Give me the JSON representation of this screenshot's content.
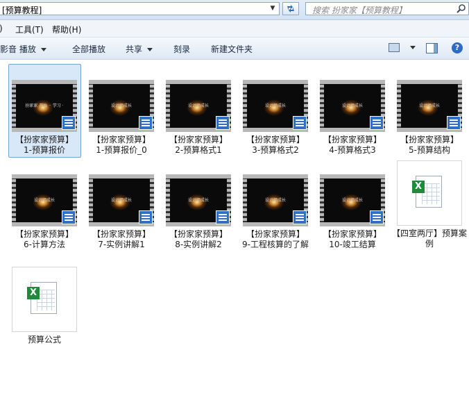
{
  "address": {
    "path": "[预算教程]",
    "search_placeholder": "搜索 扮家家【预算教程】"
  },
  "menu": {
    "tools": "工具(T)",
    "help": "帮助(H)",
    "left_partial": ")"
  },
  "commands": {
    "play_with": "影音 播放",
    "play_all": "全部播放",
    "share": "共享",
    "burn": "刻录",
    "new_folder": "新建文件夹"
  },
  "colors": {
    "accent": "#2f6fc6",
    "excel": "#1e8a3a",
    "selection": "#d9e8f8"
  },
  "files": [
    {
      "type": "video",
      "label": "【扮家家预算】1-预算报价",
      "thumb_text": "扮家家 开始 ·· 学习 ·"
    },
    {
      "type": "video",
      "label": "【扮家家预算】1-预算报价_0",
      "thumb_text": "设计师成长"
    },
    {
      "type": "video",
      "label": "【扮家家预算】2-预算格式1",
      "thumb_text": "设计师成长"
    },
    {
      "type": "video",
      "label": "【扮家家预算】3-预算格式2",
      "thumb_text": "设计师成长"
    },
    {
      "type": "video",
      "label": "【扮家家预算】4-预算格式3",
      "thumb_text": "设计师成长"
    },
    {
      "type": "video",
      "label": "【扮家家预算】5-预算结构",
      "thumb_text": "设计师成长"
    },
    {
      "type": "video",
      "label": "【扮家家预算】6-计算方法",
      "thumb_text": "设计师成长"
    },
    {
      "type": "video",
      "label": "【扮家家预算】7-实例讲解1",
      "thumb_text": "设计师成长"
    },
    {
      "type": "video",
      "label": "【扮家家预算】8-实例讲解2",
      "thumb_text": "设计师成长"
    },
    {
      "type": "video",
      "label": "【扮家家预算】9-工程核算的了解",
      "thumb_text": "设计师成长"
    },
    {
      "type": "video",
      "label": "【扮家家预算】10-竣工结算",
      "thumb_text": "设计师成长"
    },
    {
      "type": "excel",
      "label": "【四室两厅】预算案例"
    },
    {
      "type": "excel",
      "label": "预算公式"
    }
  ]
}
